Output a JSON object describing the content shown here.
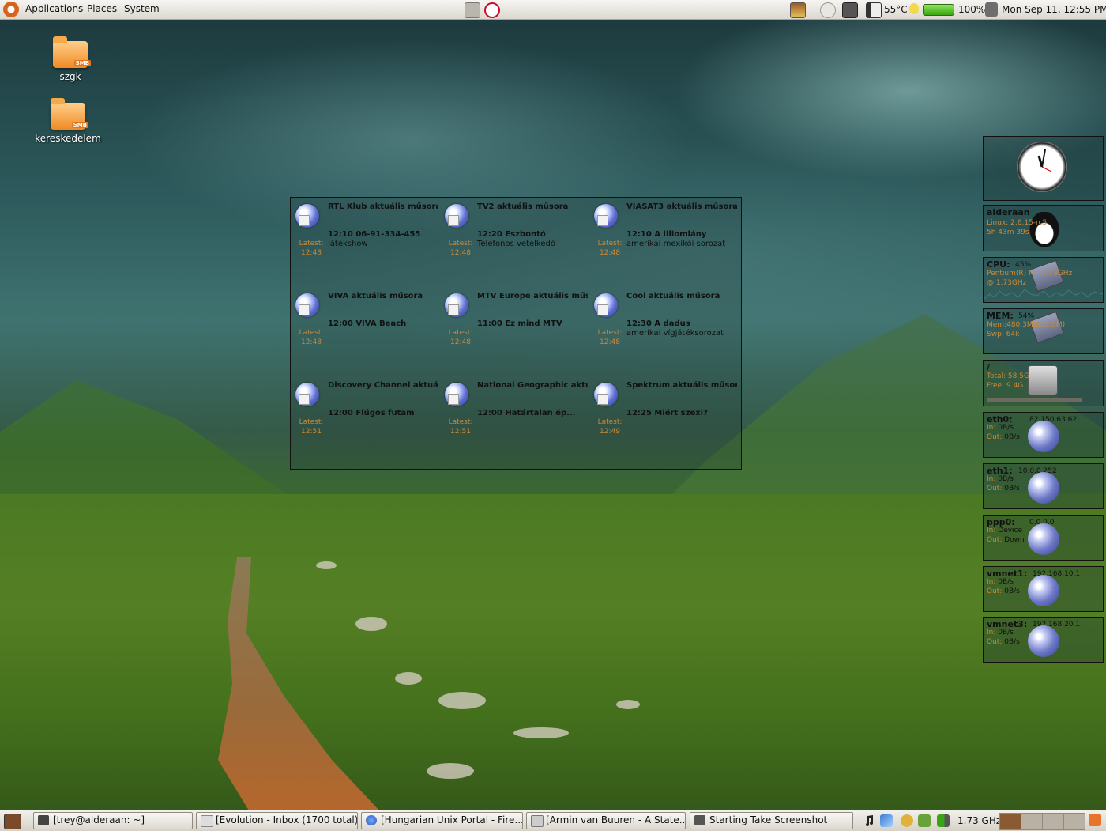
{
  "top_panel": {
    "menus": [
      "Applications",
      "Places",
      "System"
    ],
    "temperature": "55°C",
    "battery": "100%",
    "datetime": "Mon Sep 11, 12:55 PM"
  },
  "desktop_icons": [
    {
      "label": "szgk",
      "badge": "SMB"
    },
    {
      "label": "kereskedelem",
      "badge": "SMB"
    }
  ],
  "tv_programs": [
    {
      "channel": "RTL Klub aktuális műsora",
      "latest": "Latest:",
      "time": "12:48",
      "show": "12:10 06-91-334-455",
      "desc": "játékshow"
    },
    {
      "channel": "TV2 aktuális műsora",
      "latest": "Latest:",
      "time": "12:48",
      "show": "12:20 Eszbontó",
      "desc": "Telefonos vetélkedő"
    },
    {
      "channel": "VIASAT3 aktuális műsora",
      "latest": "Latest:",
      "time": "12:48",
      "show": "12:10 A liliomlány",
      "desc": "amerikai mexikói sorozat"
    },
    {
      "channel": "VIVA aktuális műsora",
      "latest": "Latest:",
      "time": "12:48",
      "show": "12:00 VIVA Beach",
      "desc": ""
    },
    {
      "channel": "MTV Europe aktuális műsora",
      "latest": "Latest:",
      "time": "12:48",
      "show": "11:00 Ez mind MTV",
      "desc": ""
    },
    {
      "channel": "Cool aktuális műsora",
      "latest": "Latest:",
      "time": "12:48",
      "show": "12:30 A dadus",
      "desc": "amerikai vígjátéksorozat"
    },
    {
      "channel": "Discovery Channel aktuális m",
      "latest": "Latest:",
      "time": "12:51",
      "show": "12:00 Flúgos futam",
      "desc": ""
    },
    {
      "channel": "National Geographic aktuális",
      "latest": "Latest:",
      "time": "12:51",
      "show": "12:00 Határtalan ép...",
      "desc": ""
    },
    {
      "channel": "Spektrum aktuális műsora",
      "latest": "Latest:",
      "time": "12:49",
      "show": "12:25 Miért szexi?",
      "desc": ""
    }
  ],
  "monitors": {
    "host": {
      "name": "alderaan",
      "line1": "Linux: 2.6.15-rc5",
      "line2": "5h 43m 39s"
    },
    "cpu": {
      "title": "CPU:",
      "value": "45%",
      "line1": "Pentium(R) M - 1.73GHz",
      "line2": "@ 1.73GHz"
    },
    "mem": {
      "title": "MEM:",
      "value": "54%",
      "line1": "Mem:480.3M(855.5M)",
      "line2": "Swp: 64k"
    },
    "disk": {
      "title": "/",
      "line1": "Total: 58.5G",
      "line2": "Free: 9.4G"
    },
    "eth0": {
      "title": "eth0:",
      "ip": "82.150.63.62",
      "in_label": "In:",
      "in": "0B/s",
      "out_label": "Out:",
      "out": "0B/s"
    },
    "eth1": {
      "title": "eth1:",
      "ip": "10.0.0.252",
      "in_label": "In:",
      "in": "0B/s",
      "out_label": "Out:",
      "out": "0B/s"
    },
    "ppp0": {
      "title": "ppp0:",
      "ip": "0.0.0.0",
      "in_label": "In:",
      "in": "Device",
      "out_label": "Out:",
      "out": "Down"
    },
    "vmnet1": {
      "title": "vmnet1:",
      "ip": "192.168.10.1",
      "in_label": "In:",
      "in": "0B/s",
      "out_label": "Out:",
      "out": "0B/s"
    },
    "vmnet3": {
      "title": "vmnet3:",
      "ip": "192.168.20.1",
      "in_label": "In:",
      "in": "0B/s",
      "out_label": "Out:",
      "out": "0B/s"
    }
  },
  "taskbar": [
    "[trey@alderaan: ~]",
    "[Evolution - Inbox (1700 total)]",
    "[Hungarian Unix Portal - Fire...",
    "[Armin van Buuren - A State...",
    "Starting Take Screenshot"
  ],
  "cpu_freq": "1.73 GHz",
  "colors": {
    "accent": "#d8641b",
    "latest_label": "#c98a3a",
    "battery": "#3aa512"
  }
}
